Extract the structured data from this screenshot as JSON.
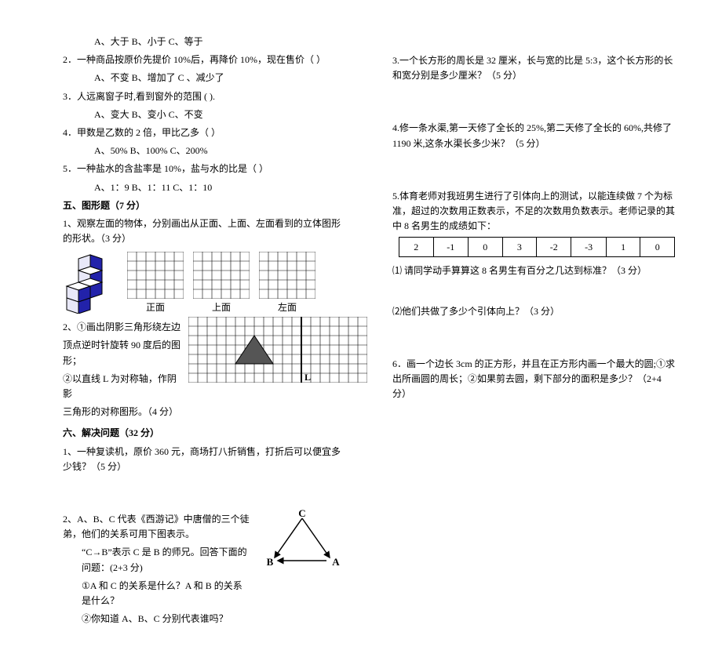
{
  "left": {
    "q_opts1": "A、大于        B、小于        C、等于",
    "q2": "2．一种商品按原价先提价 10%后，再降价 10%，现在售价（        ）",
    "q2_opts": "A、不变        B、增加了        C 、减少了",
    "q3": "3．人远离窗子时,看到窗外的范围 (        ).",
    "q3_opts": "A、变大        B、变小        C、不变",
    "q4": "4．甲数是乙数的 2 倍，甲比乙多（        ）",
    "q4_opts": "A、50%        B、100%        C、200%",
    "q5": "5．一种盐水的含盐率是 10%，盐与水的比是（        ）",
    "q5_opts": "A、1：9        B、1：11        C、1：10",
    "sec5": "五、图形题（7 分）",
    "s5q1": "1、观察左面的物体，分别画出从正面、上面、左面看到的立体图形的形状。（3 分）",
    "labels": {
      "front": "正面",
      "top": "上面",
      "left": "左面"
    },
    "s5q2a": "2、①画出阴影三角形绕左边",
    "s5q2b": "顶点逆时针旋转 90 度后的图形；",
    "s5q2c": "②以直线 L 为对称轴，作阴影",
    "s5q2d": "三角形的对称图形。（4 分）",
    "L": "L",
    "sec6": "六、解决问题（32 分）",
    "s6q1": "1、一种复读机，原价 360 元，商场打八折销售，打折后可以便宜多少钱？（5 分）",
    "s6q2a": "2、A、B、C 代表《西游记》中唐僧的三个徒弟，他们的关系可用下图表示。",
    "s6q2b": "“C→B”表示 C 是 B 的师兄。回答下面的问题：(2+3 分)",
    "s6q2c": "①A 和 C 的关系是什么？A 和 B 的关系是什么？",
    "s6q2d": "②你知道 A、B、C 分别代表谁吗？",
    "tri": {
      "A": "A",
      "B": "B",
      "C": "C"
    }
  },
  "right": {
    "q3": "3.一个长方形的周长是 32 厘米，长与宽的比是 5:3，这个长方形的长和宽分别是多少厘米？（5 分）",
    "q4": "4.修一条水渠,第一天修了全长的 25%,第二天修了全长的 60%,共修了 1190 米,这条水渠长多少米？（5 分）",
    "q5a": "5.体育老师对我班男生进行了引体向上的测试，以能连续做 7 个为标准，超过的次数用正数表示，不足的次数用负数表示。老师记录的其中 8 名男生的成绩如下：",
    "table": [
      "2",
      "-1",
      "0",
      "3",
      "-2",
      "-3",
      "1",
      "0"
    ],
    "q5b": "⑴ 请同学动手算算这 8 名男生有百分之几达到标准？（3 分）",
    "q5c": "⑵他们共做了多少个引体向上？（3 分）",
    "q6": "6．画一个边长 3cm 的正方形，并且在正方形内画一个最大的圆;①求出所画圆的周长；②如果剪去圆，剩下部分的面积是多少？（2+4 分）"
  }
}
